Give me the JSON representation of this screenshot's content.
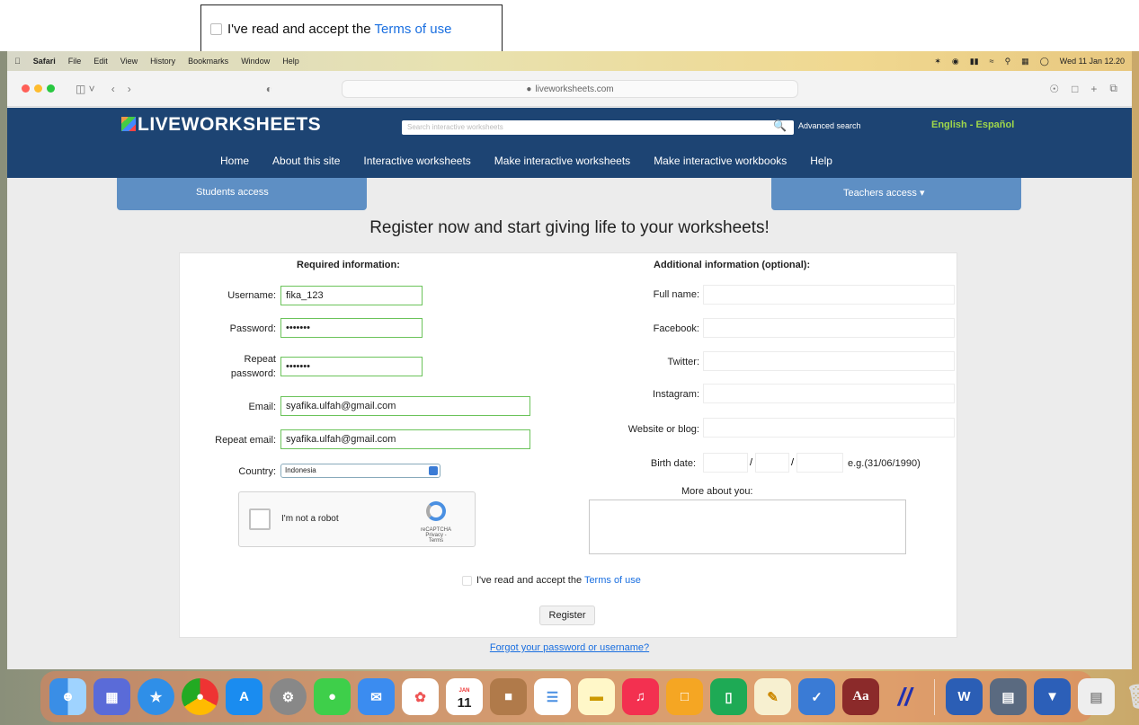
{
  "callout": {
    "text": "I've read and accept the ",
    "link": "Terms of use"
  },
  "menubar": {
    "app": "Safari",
    "items": [
      "File",
      "Edit",
      "View",
      "History",
      "Bookmarks",
      "Window",
      "Help"
    ],
    "clock": "Wed 11 Jan 12.20"
  },
  "browser": {
    "url": "liveworksheets.com"
  },
  "site": {
    "logo": "LIVEWORKSHEETS",
    "search_placeholder": "Search interactive worksheets",
    "advanced": "Advanced search",
    "language": "English - Español",
    "nav": [
      "Home",
      "About this site",
      "Interactive worksheets",
      "Make interactive worksheets",
      "Make interactive workbooks",
      "Help"
    ],
    "students": "Students access",
    "teachers": "Teachers access"
  },
  "headline": "Register now and start giving life to your worksheets!",
  "required": {
    "title": "Required information:",
    "username_label": "Username:",
    "username": "fika_123",
    "password_label": "Password:",
    "password": "•••••••",
    "repeat_password_label": "Repeat password:",
    "repeat_password": "•••••••",
    "email_label": "Email:",
    "email": "syafika.ulfah@gmail.com",
    "repeat_email_label": "Repeat email:",
    "repeat_email": "syafika.ulfah@gmail.com",
    "country_label": "Country:",
    "country": "Indonesia"
  },
  "captcha": {
    "label": "I'm not a robot",
    "brand": "reCAPTCHA",
    "links": "Privacy - Terms"
  },
  "optional": {
    "title": "Additional information (optional):",
    "fullname_label": "Full name:",
    "facebook_label": "Facebook:",
    "twitter_label": "Twitter:",
    "instagram_label": "Instagram:",
    "website_label": "Website or blog:",
    "birth_label": "Birth date:",
    "birth_hint": "e.g.(31/06/1990)",
    "more_label": "More about you:"
  },
  "terms": {
    "text": "I've read and accept the ",
    "link": "Terms of use"
  },
  "register": "Register",
  "forgot": "Forgot your password or username?",
  "dock_calendar_day": "11",
  "dock_calendar_month": "JAN"
}
